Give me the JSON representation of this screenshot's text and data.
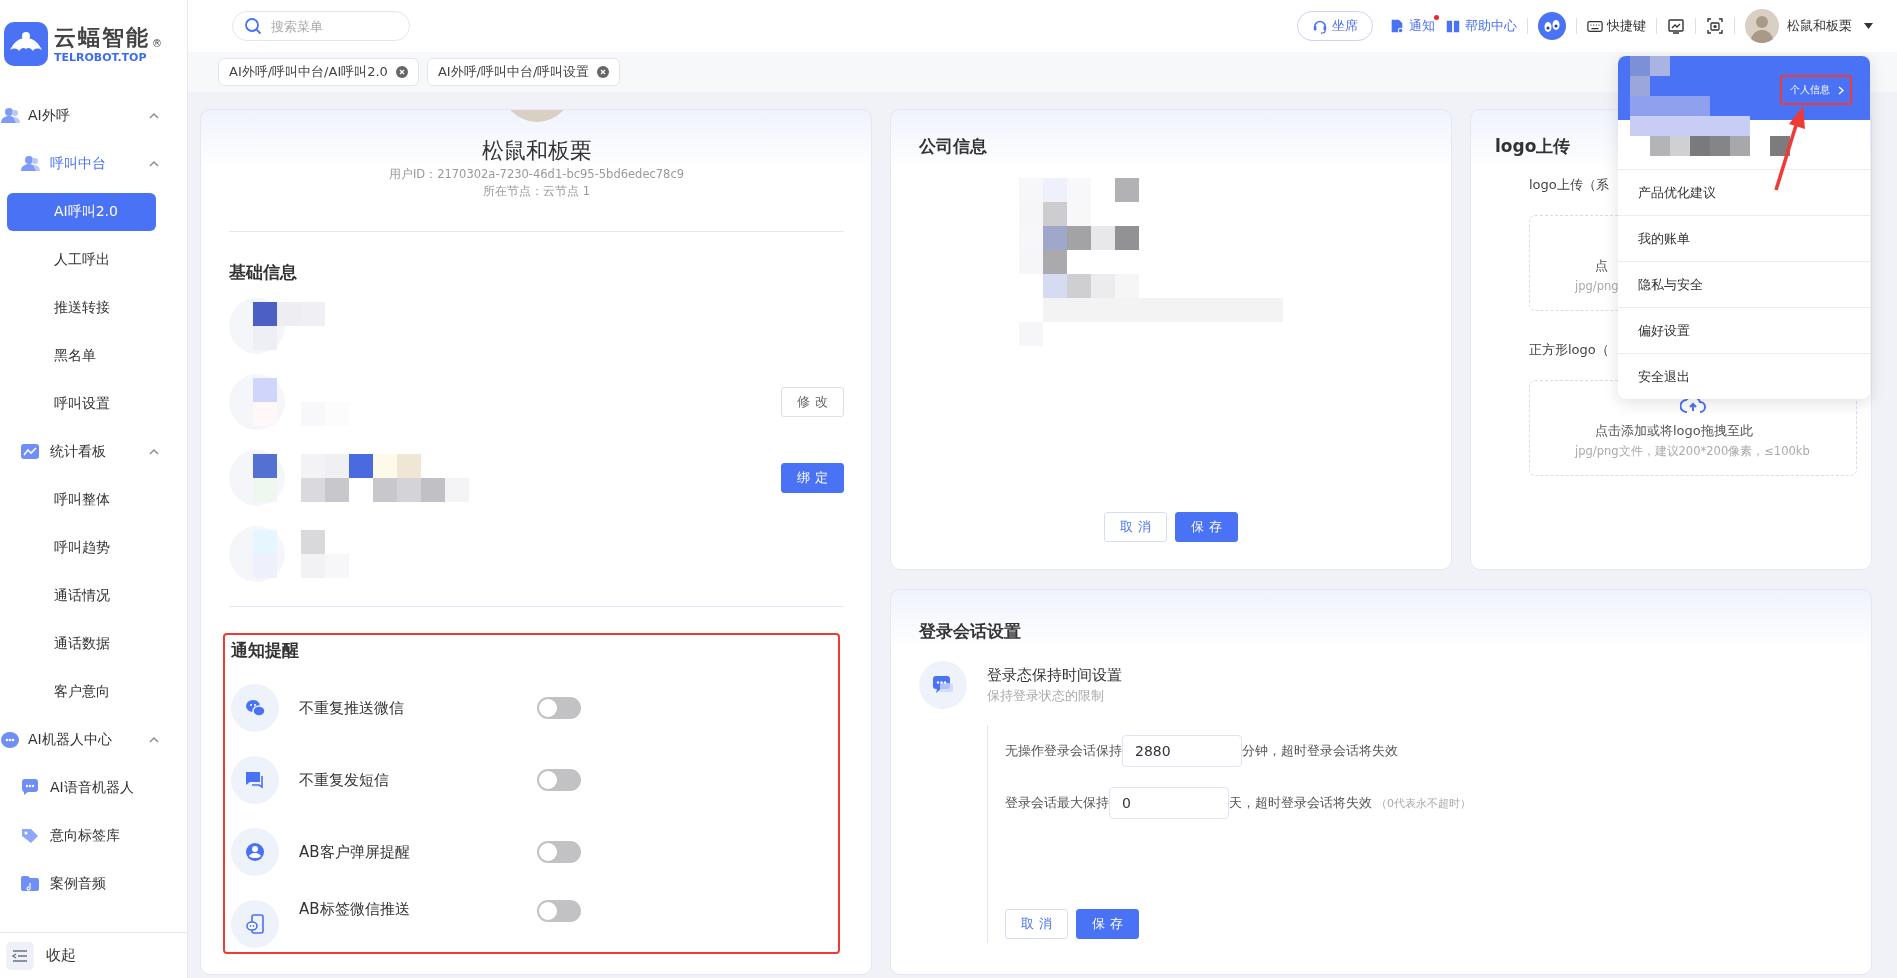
{
  "sidebar": {
    "brand": "云蝠智能",
    "brand_mark": "®",
    "subtitle": "TELROBOT.TOP",
    "items": [
      {
        "label": "AI外呼",
        "expanded": true,
        "selected": false,
        "children": [
          {
            "label": "呼叫中台",
            "expanded": true,
            "selected": false,
            "children": [
              {
                "label": "AI呼叫2.0",
                "selected": true
              },
              {
                "label": "人工呼出",
                "selected": false
              },
              {
                "label": "推送转接",
                "selected": false
              },
              {
                "label": "黑名单",
                "selected": false
              },
              {
                "label": "呼叫设置",
                "selected": false
              }
            ]
          },
          {
            "label": "统计看板",
            "expanded": true,
            "selected": false,
            "children": [
              {
                "label": "呼叫整体",
                "selected": false
              },
              {
                "label": "呼叫趋势",
                "selected": false
              },
              {
                "label": "通话情况",
                "selected": false
              },
              {
                "label": "通话数据",
                "selected": false
              },
              {
                "label": "客户意向",
                "selected": false
              }
            ]
          }
        ]
      },
      {
        "label": "AI机器人中心",
        "expanded": true,
        "selected": false,
        "children": [
          {
            "label": "AI语音机器人",
            "selected": false
          },
          {
            "label": "意向标签库",
            "selected": false
          },
          {
            "label": "案例音频",
            "selected": false
          }
        ]
      }
    ],
    "collapse": "收起"
  },
  "topbar": {
    "search_placeholder": "搜索菜单",
    "actions": [
      {
        "kind": "button",
        "label": "坐席",
        "unread": false
      },
      {
        "kind": "link",
        "label": "通知",
        "unread": true
      },
      {
        "kind": "link",
        "label": "帮助中心",
        "unread": false
      },
      {
        "kind": "logo"
      },
      {
        "kind": "link",
        "label": "快捷键",
        "unread": false
      },
      {
        "kind": "icon"
      },
      {
        "kind": "icon"
      }
    ],
    "user": "松鼠和板栗"
  },
  "tabs": [
    {
      "label": "AI外呼/呼叫中台/AI呼叫2.0"
    },
    {
      "label": "AI外呼/呼叫中台/呼叫设置"
    }
  ],
  "profile": {
    "name": "松鼠和板栗",
    "user_id": "用户ID：2170302a-7230-46d1-bc95-5bd6edec78c9",
    "node": "所在节点：云节点 1"
  },
  "basic_info": {
    "title": "基础信息",
    "buttons": [
      {
        "label": "修 改",
        "kind": "outline"
      },
      {
        "label": "绑 定",
        "kind": "primary"
      }
    ]
  },
  "notifications": {
    "title": "通知提醒",
    "highlighted": true,
    "items": [
      {
        "label": "不重复推送微信",
        "on": false
      },
      {
        "label": "不重复发短信",
        "on": false
      },
      {
        "label": "AB客户弹屏提醒",
        "on": false
      },
      {
        "label": "AB标签微信推送",
        "on": false
      }
    ]
  },
  "company": {
    "title": "公司信息",
    "buttons": [
      {
        "label": "取 消",
        "kind": "outline"
      },
      {
        "label": "保 存",
        "kind": "primary"
      }
    ]
  },
  "logo_upload": {
    "title": "logo上传",
    "sections": [
      {
        "label": "logo上传（系",
        "upload_text": "点",
        "hint": "jpg/png",
        "upload_icon": false
      },
      {
        "label": "正方形logo（",
        "upload_text": "点击添加或将logo拖拽至此",
        "hint": "jpg/png文件，建议200*200像素，≤100kb",
        "upload_icon": true
      }
    ]
  },
  "session": {
    "title": "登录会话设置",
    "setting_title": "登录态保持时间设置",
    "setting_desc": "保持登录状态的限制",
    "rows": [
      {
        "label": "无操作登录会话保持",
        "value": "2880",
        "suffix": "分钟，超时登录会话将失效"
      },
      {
        "label": "登录会话最大保持",
        "value": "0",
        "suffix": "天，超时登录会话将失效",
        "note": "（0代表永不超时）"
      }
    ],
    "buttons": [
      {
        "label": "取 消",
        "kind": "outline"
      },
      {
        "label": "保 存",
        "kind": "primary"
      }
    ]
  },
  "user_menu": {
    "profile_button": {
      "label": "个人信息",
      "highlighted": true
    },
    "arrow": true,
    "items": [
      {
        "label": "产品优化建议"
      },
      {
        "label": "我的账单"
      },
      {
        "label": "隐私与安全"
      },
      {
        "label": "偏好设置"
      },
      {
        "label": "安全退出"
      }
    ]
  }
}
